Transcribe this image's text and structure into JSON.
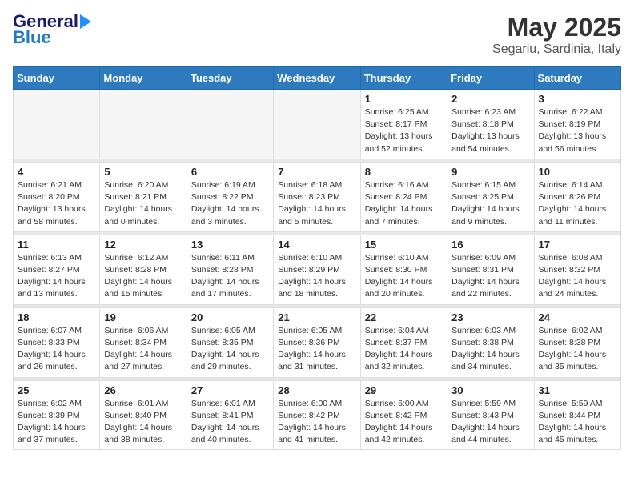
{
  "header": {
    "logo_general": "General",
    "logo_blue": "Blue",
    "main_title": "May 2025",
    "subtitle": "Segariu, Sardinia, Italy"
  },
  "weekdays": [
    "Sunday",
    "Monday",
    "Tuesday",
    "Wednesday",
    "Thursday",
    "Friday",
    "Saturday"
  ],
  "weeks": [
    [
      {
        "day": "",
        "empty": true
      },
      {
        "day": "",
        "empty": true
      },
      {
        "day": "",
        "empty": true
      },
      {
        "day": "",
        "empty": true
      },
      {
        "day": "1",
        "sunrise": "6:25 AM",
        "sunset": "8:17 PM",
        "daylight": "13 hours and 52 minutes."
      },
      {
        "day": "2",
        "sunrise": "6:23 AM",
        "sunset": "8:18 PM",
        "daylight": "13 hours and 54 minutes."
      },
      {
        "day": "3",
        "sunrise": "6:22 AM",
        "sunset": "8:19 PM",
        "daylight": "13 hours and 56 minutes."
      }
    ],
    [
      {
        "day": "4",
        "sunrise": "6:21 AM",
        "sunset": "8:20 PM",
        "daylight": "13 hours and 58 minutes."
      },
      {
        "day": "5",
        "sunrise": "6:20 AM",
        "sunset": "8:21 PM",
        "daylight": "14 hours and 0 minutes."
      },
      {
        "day": "6",
        "sunrise": "6:19 AM",
        "sunset": "8:22 PM",
        "daylight": "14 hours and 3 minutes."
      },
      {
        "day": "7",
        "sunrise": "6:18 AM",
        "sunset": "8:23 PM",
        "daylight": "14 hours and 5 minutes."
      },
      {
        "day": "8",
        "sunrise": "6:16 AM",
        "sunset": "8:24 PM",
        "daylight": "14 hours and 7 minutes."
      },
      {
        "day": "9",
        "sunrise": "6:15 AM",
        "sunset": "8:25 PM",
        "daylight": "14 hours and 9 minutes."
      },
      {
        "day": "10",
        "sunrise": "6:14 AM",
        "sunset": "8:26 PM",
        "daylight": "14 hours and 11 minutes."
      }
    ],
    [
      {
        "day": "11",
        "sunrise": "6:13 AM",
        "sunset": "8:27 PM",
        "daylight": "14 hours and 13 minutes."
      },
      {
        "day": "12",
        "sunrise": "6:12 AM",
        "sunset": "8:28 PM",
        "daylight": "14 hours and 15 minutes."
      },
      {
        "day": "13",
        "sunrise": "6:11 AM",
        "sunset": "8:28 PM",
        "daylight": "14 hours and 17 minutes."
      },
      {
        "day": "14",
        "sunrise": "6:10 AM",
        "sunset": "8:29 PM",
        "daylight": "14 hours and 18 minutes."
      },
      {
        "day": "15",
        "sunrise": "6:10 AM",
        "sunset": "8:30 PM",
        "daylight": "14 hours and 20 minutes."
      },
      {
        "day": "16",
        "sunrise": "6:09 AM",
        "sunset": "8:31 PM",
        "daylight": "14 hours and 22 minutes."
      },
      {
        "day": "17",
        "sunrise": "6:08 AM",
        "sunset": "8:32 PM",
        "daylight": "14 hours and 24 minutes."
      }
    ],
    [
      {
        "day": "18",
        "sunrise": "6:07 AM",
        "sunset": "8:33 PM",
        "daylight": "14 hours and 26 minutes."
      },
      {
        "day": "19",
        "sunrise": "6:06 AM",
        "sunset": "8:34 PM",
        "daylight": "14 hours and 27 minutes."
      },
      {
        "day": "20",
        "sunrise": "6:05 AM",
        "sunset": "8:35 PM",
        "daylight": "14 hours and 29 minutes."
      },
      {
        "day": "21",
        "sunrise": "6:05 AM",
        "sunset": "8:36 PM",
        "daylight": "14 hours and 31 minutes."
      },
      {
        "day": "22",
        "sunrise": "6:04 AM",
        "sunset": "8:37 PM",
        "daylight": "14 hours and 32 minutes."
      },
      {
        "day": "23",
        "sunrise": "6:03 AM",
        "sunset": "8:38 PM",
        "daylight": "14 hours and 34 minutes."
      },
      {
        "day": "24",
        "sunrise": "6:02 AM",
        "sunset": "8:38 PM",
        "daylight": "14 hours and 35 minutes."
      }
    ],
    [
      {
        "day": "25",
        "sunrise": "6:02 AM",
        "sunset": "8:39 PM",
        "daylight": "14 hours and 37 minutes."
      },
      {
        "day": "26",
        "sunrise": "6:01 AM",
        "sunset": "8:40 PM",
        "daylight": "14 hours and 38 minutes."
      },
      {
        "day": "27",
        "sunrise": "6:01 AM",
        "sunset": "8:41 PM",
        "daylight": "14 hours and 40 minutes."
      },
      {
        "day": "28",
        "sunrise": "6:00 AM",
        "sunset": "8:42 PM",
        "daylight": "14 hours and 41 minutes."
      },
      {
        "day": "29",
        "sunrise": "6:00 AM",
        "sunset": "8:42 PM",
        "daylight": "14 hours and 42 minutes."
      },
      {
        "day": "30",
        "sunrise": "5:59 AM",
        "sunset": "8:43 PM",
        "daylight": "14 hours and 44 minutes."
      },
      {
        "day": "31",
        "sunrise": "5:59 AM",
        "sunset": "8:44 PM",
        "daylight": "14 hours and 45 minutes."
      }
    ]
  ]
}
